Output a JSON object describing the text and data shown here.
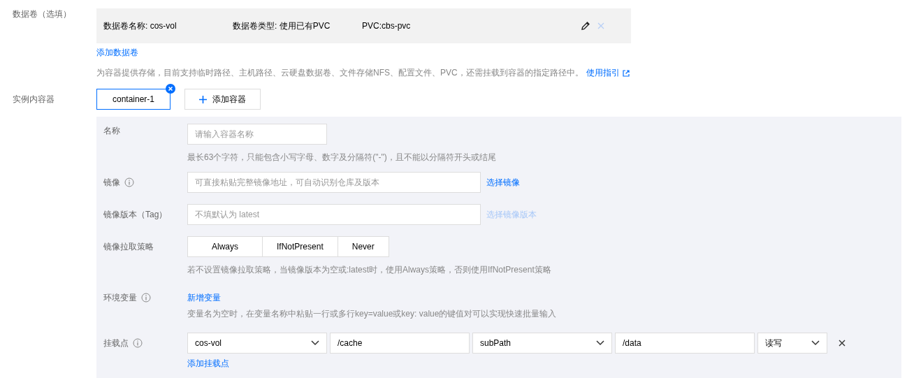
{
  "volumes": {
    "label": "数据卷（选填）",
    "items": [
      {
        "name": "数据卷名称: cos-vol",
        "type": "数据卷类型: 使用已有PVC",
        "pvc": "PVC:cbs-pvc"
      }
    ],
    "add_link": "添加数据卷",
    "description": "为容器提供存储，目前支持临时路径、主机路径、云硬盘数据卷、文件存储NFS、配置文件、PVC，还需挂载到容器的指定路径中。",
    "guide_link": "使用指引"
  },
  "containers": {
    "label": "实例内容器",
    "tabs": [
      {
        "label": "container-1",
        "selected": true
      }
    ],
    "add_button": "添加容器"
  },
  "form": {
    "name": {
      "label": "名称",
      "placeholder": "请输入容器名称",
      "hint": "最长63个字符，只能包含小写字母、数字及分隔符(\"-\")，且不能以分隔符开头或结尾"
    },
    "image": {
      "label": "镜像",
      "placeholder": "可直接粘贴完整镜像地址，可自动识别仓库及版本",
      "link": "选择镜像",
      "link_disabled": false
    },
    "tag": {
      "label": "镜像版本（Tag）",
      "placeholder": "不填默认为 latest",
      "link": "选择镜像版本",
      "link_disabled": true
    },
    "pull_policy": {
      "label": "镜像拉取策略",
      "options": [
        {
          "label": "Always",
          "selected": false
        },
        {
          "label": "IfNotPresent",
          "selected": false
        },
        {
          "label": "Never",
          "selected": false
        }
      ],
      "hint": "若不设置镜像拉取策略，当镜像版本为空或:latest时，使用Always策略，否则使用IfNotPresent策略"
    },
    "env": {
      "label": "环境变量",
      "link": "新增变量",
      "hint": "变量名为空时，在变量名称中粘贴一行或多行key=value或key: value的键值对可以实现快速批量输入"
    },
    "mounts": {
      "label": "挂载点",
      "rows": [
        {
          "volume": "cos-vol",
          "path": "/cache",
          "mode": "subPath",
          "sub_path": "/data",
          "access": "读写"
        }
      ],
      "add_link": "添加挂载点"
    }
  }
}
